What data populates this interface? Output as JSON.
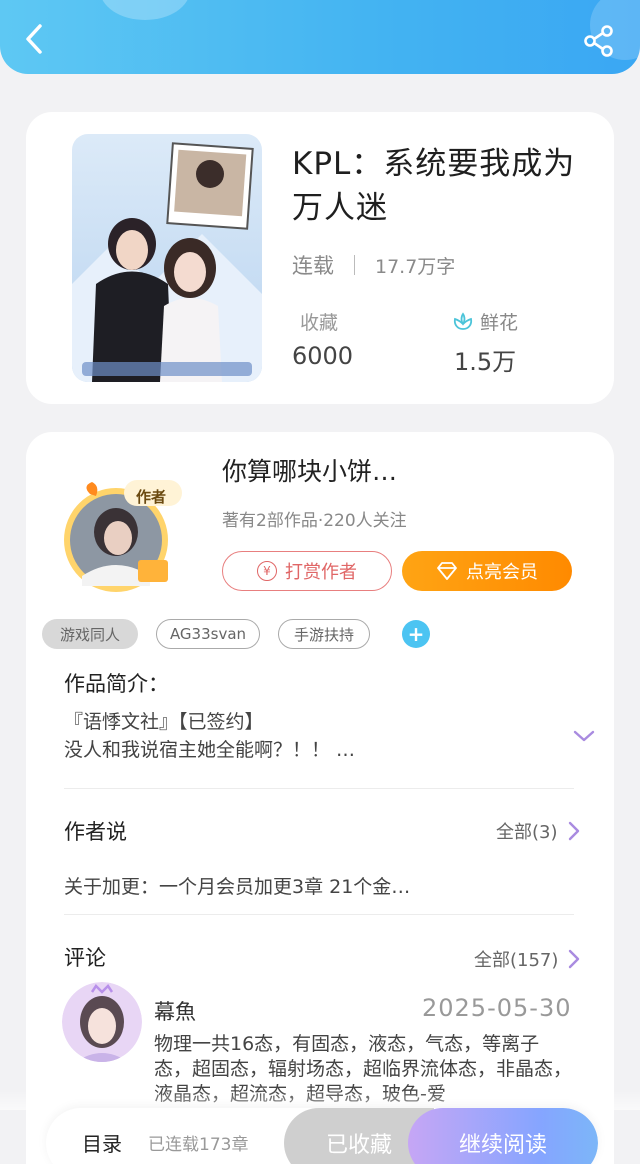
{
  "book": {
    "title": "KPL：系统要我成为万人迷",
    "status": "连载",
    "word_count": "17.7万字",
    "collect_label": "收藏",
    "collect_value": "6000",
    "flower_label": "鲜花",
    "flower_value": "1.5万"
  },
  "author": {
    "name": "你算哪块小饼…",
    "sub": "著有2部作品·220人关注",
    "badge": "作者",
    "tip_label": "打赏作者",
    "vip_label": "点亮会员",
    "tags": [
      "游戏同人",
      "AG33svan",
      "手游扶持"
    ]
  },
  "intro": {
    "title": "作品简介：",
    "line1": "『语悸文社』【已签约】",
    "line2": "没人和我说宿主她全能啊？！！ …"
  },
  "author_says": {
    "title": "作者说",
    "all_label": "全部(3)",
    "text": "关于加更：一个月会员加更3章 21个金…"
  },
  "comments": {
    "title": "评论",
    "all_label": "全部(157)",
    "first": {
      "name": "幕魚",
      "date": "2025-05-30",
      "text": "物理一共16态，有固态，液态，气态，等离子态，超固态，辐射场态，超临界流体态，非晶态，液晶态，超流态，超导态，玻色-爱"
    }
  },
  "bottom_bar": {
    "toc_label": "目录",
    "toc_sub": "已连载173章",
    "collected_label": "已收藏",
    "read_label": "继续阅读"
  },
  "colors": {
    "header_blue": "#43b3f2",
    "vip_orange": "#ff9a0a",
    "tip_red": "#e06666",
    "chevron_purple": "#a98be0"
  }
}
